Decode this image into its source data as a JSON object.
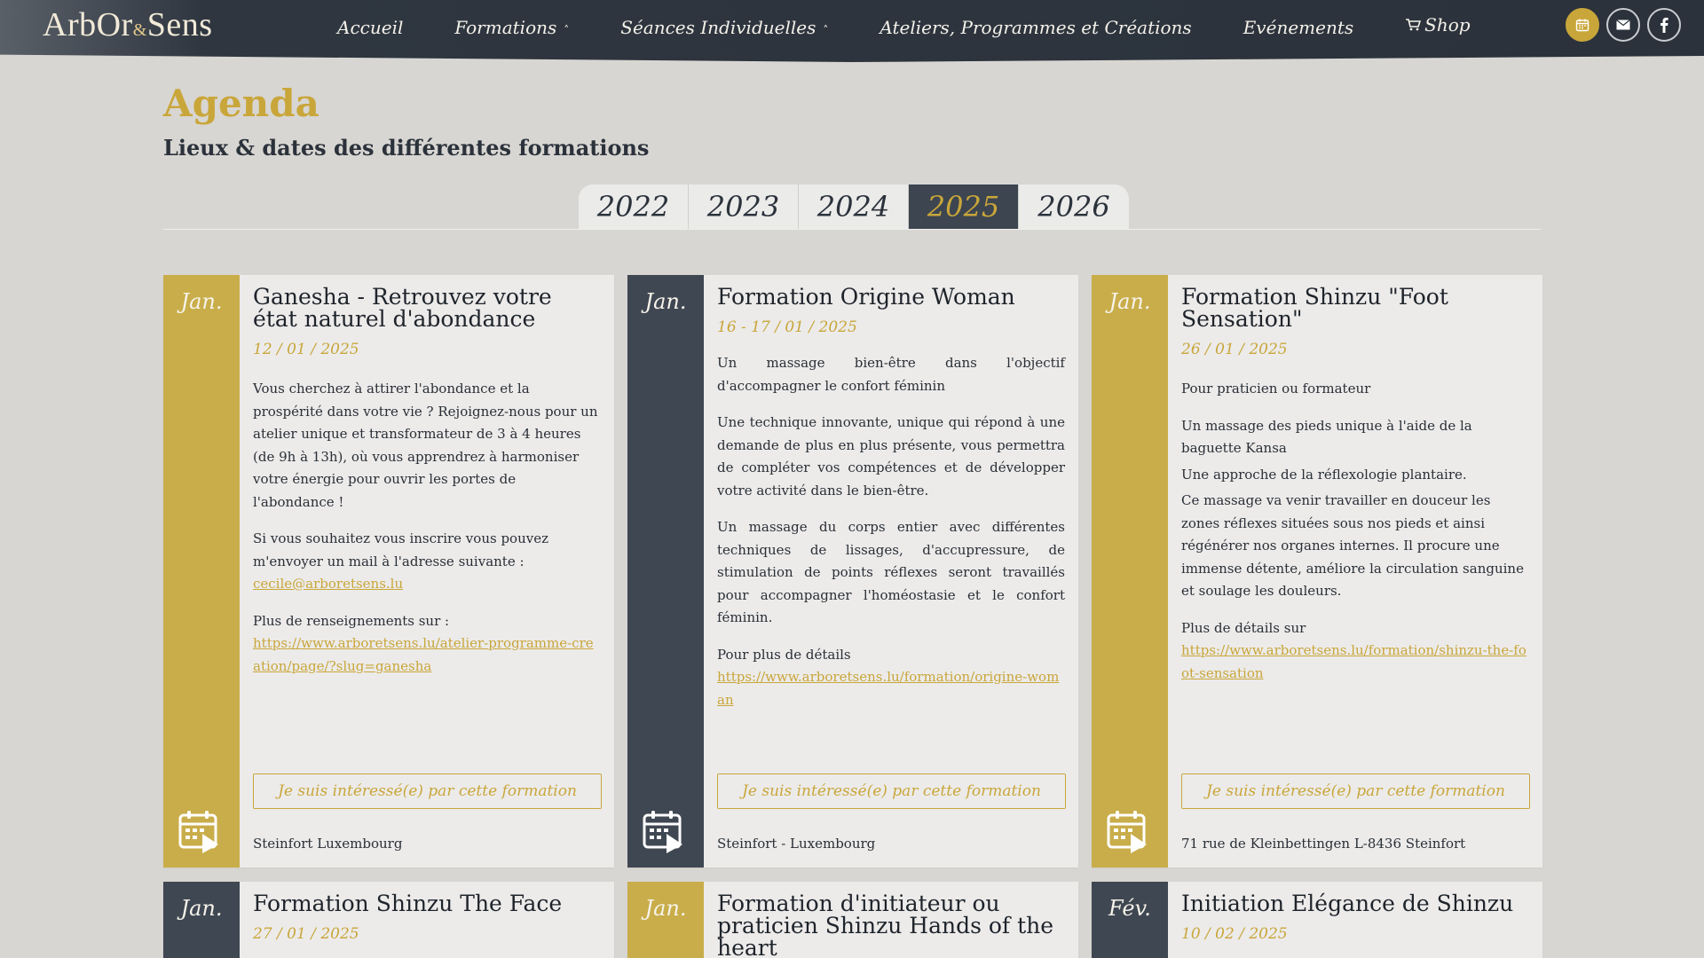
{
  "header": {
    "logo": {
      "part1": "ArbOr",
      "amp": "&",
      "part2": "Sens"
    },
    "nav": [
      {
        "label": "Accueil",
        "has_dropdown": false
      },
      {
        "label": "Formations",
        "has_dropdown": true
      },
      {
        "label": "Séances Individuelles",
        "has_dropdown": true
      },
      {
        "label": "Ateliers, Programmes et Créations",
        "has_dropdown": false
      },
      {
        "label": "Evénements",
        "has_dropdown": false
      },
      {
        "label": "Shop",
        "has_dropdown": false,
        "icon": "cart-icon"
      }
    ],
    "icons": [
      {
        "name": "calendar-icon",
        "active": true
      },
      {
        "name": "mail-icon",
        "active": false
      },
      {
        "name": "facebook-icon",
        "active": false
      }
    ]
  },
  "page": {
    "title": "Agenda",
    "subtitle": "Lieux & dates des différentes formations"
  },
  "tabs": [
    {
      "label": "2022",
      "active": false
    },
    {
      "label": "2023",
      "active": false
    },
    {
      "label": "2024",
      "active": false
    },
    {
      "label": "2025",
      "active": true
    },
    {
      "label": "2026",
      "active": false
    }
  ],
  "cta_label": "Je suis intéressé(e) par cette formation",
  "cards": [
    {
      "month": "Jan.",
      "side": "gold",
      "title": "Ganesha - Retrouvez votre état naturel d'abondance",
      "date": "12 / 01 / 2025",
      "paragraphs": [
        {
          "text": "Vous cherchez à attirer l'abondance et la prospérité dans votre vie ? Rejoignez-nous pour un atelier unique et transformateur de 3 à 4 heures (de 9h à 13h), où vous apprendrez à harmoniser votre énergie pour ouvrir les portes de l'abondance !"
        },
        {
          "text": "Si vous souhaitez vous inscrire vous pouvez m'envoyer un mail à l'adresse suivante :",
          "link": "cecile@arboretsens.lu"
        },
        {
          "text": "Plus de renseignements sur :",
          "link": "https://www.arboretsens.lu/atelier-programme-creation/page/?slug=ganesha"
        }
      ],
      "location": "Steinfort Luxembourg"
    },
    {
      "month": "Jan.",
      "side": "dark",
      "title": "Formation Origine Woman",
      "date": "16 - 17 / 01 / 2025",
      "paragraphs": [
        {
          "text": "Un massage bien-être dans l'objectif d'accompagner le confort féminin"
        },
        {
          "text": "Une technique innovante, unique qui répond à une demande de plus en plus présente, vous permettra de compléter vos compétences et de développer votre activité dans le bien-être."
        },
        {
          "text": "Un massage du corps entier avec différentes techniques de lissages, d'accupressure, de stimulation de points réflexes seront travaillés pour accompagner l'homéostasie et le confort féminin."
        },
        {
          "text": "Pour plus de détails",
          "link": "https://www.arboretsens.lu/formation/origine-woman"
        }
      ],
      "location": "Steinfort - Luxembourg"
    },
    {
      "month": "Jan.",
      "side": "gold",
      "title": "Formation Shinzu \"Foot Sensation\"",
      "date": "26 / 01 / 2025",
      "paragraphs": [
        {
          "text": "Pour praticien ou formateur"
        },
        {
          "text": "Un massage des pieds unique à l'aide de la baguette Kansa",
          "tight": true
        },
        {
          "text": "Une approche de la réflexologie plantaire.",
          "tight": true
        },
        {
          "text": "Ce massage va venir travailler en douceur les zones réflexes situées sous nos pieds et ainsi régénérer nos organes internes. Il procure une immense détente, améliore la circulation sanguine et soulage les douleurs."
        },
        {
          "text": "Plus de détails sur",
          "link": "https://www.arboretsens.lu/formation/shinzu-the-foot-sensation"
        }
      ],
      "location": "71 rue de Kleinbettingen L-8436 Steinfort"
    },
    {
      "month": "Jan.",
      "side": "dark",
      "title": "Formation Shinzu The Face",
      "date": "27 / 01 / 2025"
    },
    {
      "month": "Jan.",
      "side": "gold",
      "title": "Formation d'initiateur ou praticien Shinzu Hands of the heart",
      "date": ""
    },
    {
      "month": "Fév.",
      "side": "dark",
      "title": "Initiation Elégance de Shinzu",
      "date": "10 / 02 / 2025"
    }
  ],
  "colors": {
    "accent": "#c9a63a",
    "dark": "#3f4752",
    "background": "#d8d6d2",
    "card": "#ecebea"
  }
}
